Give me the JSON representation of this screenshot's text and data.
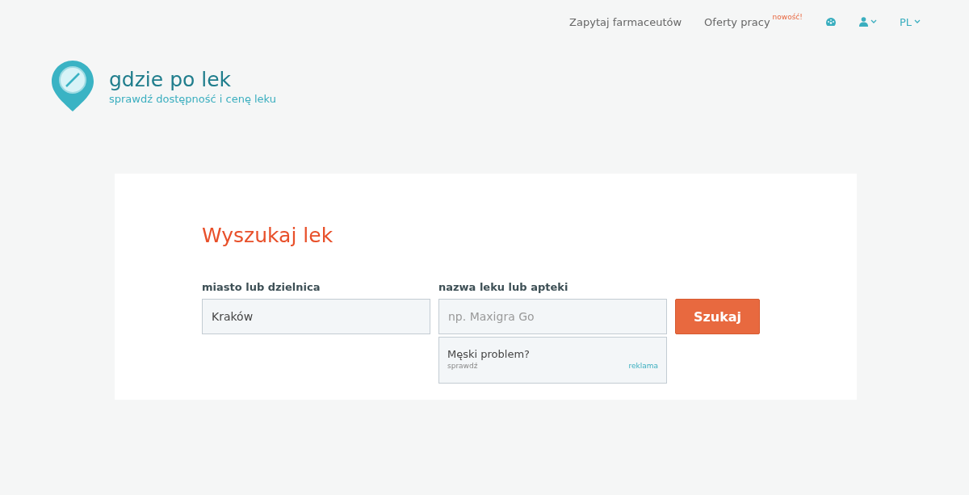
{
  "nav": {
    "links": [
      {
        "label": "Zapytaj farmaceutów"
      },
      {
        "label": "Oferty pracy",
        "badge": "nowość!"
      }
    ],
    "language": "PL"
  },
  "logo": {
    "title": "gdzie po lek",
    "tagline": "sprawdź dostępność i cenę leku"
  },
  "search": {
    "heading": "Wyszukaj lek",
    "city": {
      "label": "miasto lub dzielnica",
      "value": "Kraków"
    },
    "drug": {
      "label": "nazwa leku lub apteki",
      "placeholder": "np. Maxigra Go"
    },
    "button": "Szukaj",
    "ad": {
      "title": "Męski problem?",
      "link": "sprawdź",
      "tag": "reklama"
    }
  }
}
